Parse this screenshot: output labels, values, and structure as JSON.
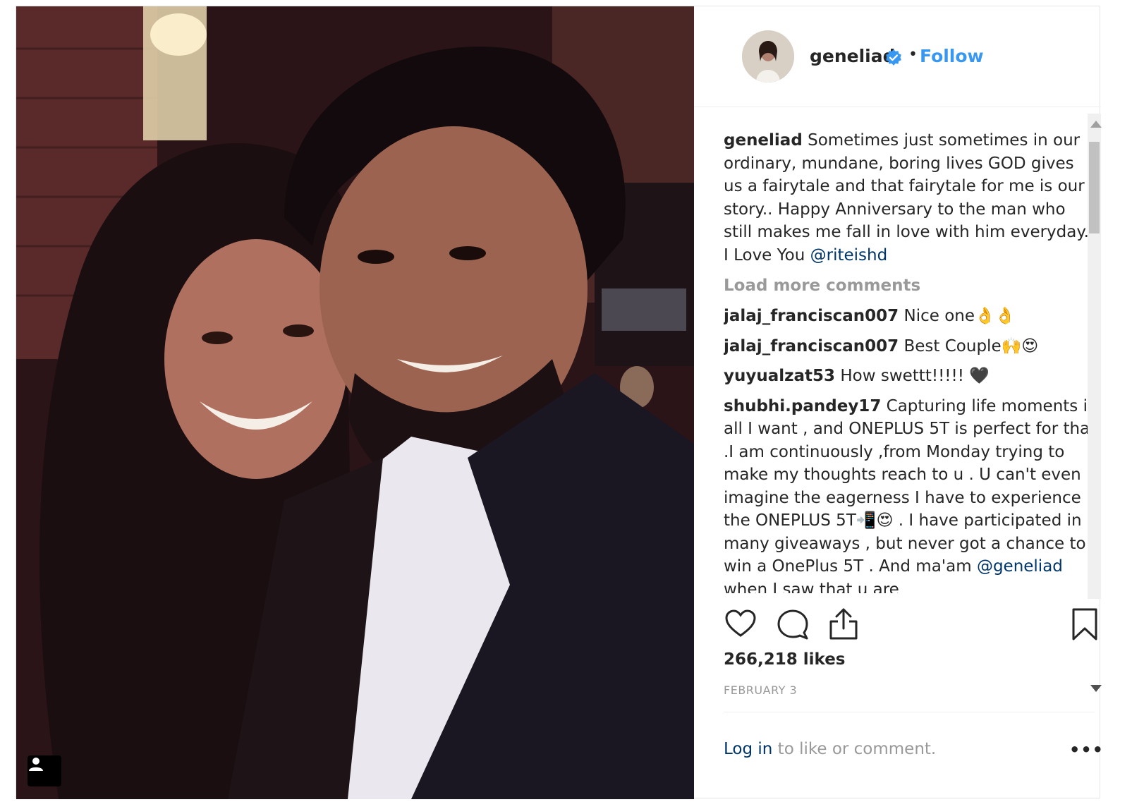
{
  "post": {
    "username": "geneliad",
    "follow_label": "Follow",
    "separator": "•",
    "caption": {
      "user": "geneliad",
      "text": " Sometimes just sometimes in our ordinary, mundane, boring lives GOD gives us a fairytale and that fairytale for me is our story.. Happy Anniversary to the man who still makes me fall in love with him everyday.. I Love You ",
      "mention": "@riteishd"
    },
    "load_more_label": "Load more comments",
    "comments": [
      {
        "user": "jalaj_franciscan007",
        "text": " Nice one👌👌"
      },
      {
        "user": "jalaj_franciscan007",
        "text": " Best Couple🙌😍"
      },
      {
        "user": "yuyualzat53",
        "text": " How swettt!!!!! 🖤"
      },
      {
        "user": "shubhi.pandey17",
        "text": " Capturing life moments is all I want , and ONEPLUS 5T is perfect for that .I am continuously ,from Monday trying to make my thoughts reach to u . U can't even imagine the eagerness I have to experience the ONEPLUS 5T📲😍 . I have participated in many giveaways , but never got a chance to win a OnePlus 5T . And ma'am ",
        "mention": "@geneliad",
        "text_after": " when I saw that u are"
      }
    ],
    "likes": "266,218 likes",
    "date": "FEBRUARY 3",
    "login": {
      "link": "Log in",
      "rest": " to like or comment."
    },
    "more_label": "•••",
    "colors": {
      "link": "#3897f0",
      "mention": "#003569",
      "muted": "#999999",
      "verified": "#3897f0"
    }
  }
}
